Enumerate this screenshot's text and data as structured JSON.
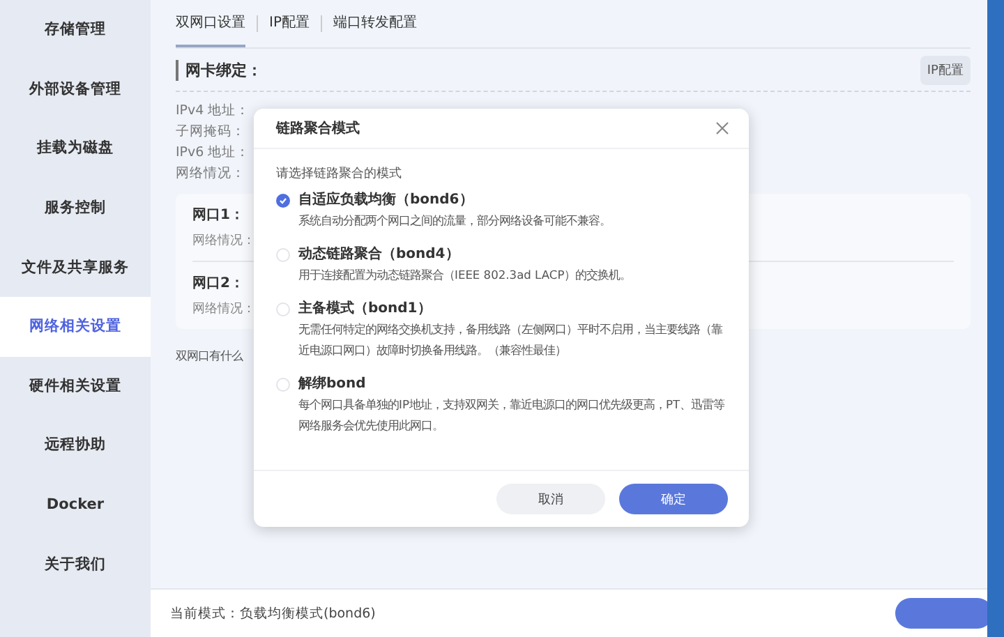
{
  "sidebar": {
    "items": [
      {
        "label": "存储管理",
        "selected": false
      },
      {
        "label": "外部设备管理",
        "selected": false
      },
      {
        "label": "挂载为磁盘",
        "selected": false
      },
      {
        "label": "服务控制",
        "selected": false
      },
      {
        "label": "文件及共享服务",
        "selected": false
      },
      {
        "label": "网络相关设置",
        "selected": true
      },
      {
        "label": "硬件相关设置",
        "selected": false
      },
      {
        "label": "远程协助",
        "selected": false
      },
      {
        "label": "Docker",
        "selected": false
      },
      {
        "label": "关于我们",
        "selected": false
      }
    ]
  },
  "tabs": [
    {
      "label": "双网口设置",
      "selected": true
    },
    {
      "label": "IP配置",
      "selected": false
    },
    {
      "label": "端口转发配置",
      "selected": false
    }
  ],
  "section": {
    "title": "网卡绑定：",
    "button": "IP配置",
    "info": [
      "IPv4 地址：",
      "子网掩码：",
      "IPv6 地址：",
      "网络情况："
    ],
    "ports": [
      {
        "name": "网口1：",
        "status_label": "网络情况："
      },
      {
        "name": "网口2：",
        "status_label": "网络情况："
      }
    ],
    "faq": "双网口有什么"
  },
  "dialog": {
    "title": "链路聚合模式",
    "prompt": "请选择链路聚合的模式",
    "options": [
      {
        "title": "自适应负载均衡（bond6）",
        "description": "系统自动分配两个网口之间的流量，部分网络设备可能不兼容。",
        "selected": true
      },
      {
        "title": "动态链路聚合（bond4）",
        "description": "用于连接配置为动态链路聚合（IEEE 802.3ad LACP）的交换机。",
        "selected": false
      },
      {
        "title": "主备模式（bond1）",
        "description": "无需任何特定的网络交换机支持，备用线路（左侧网口）平时不启用，当主要线路（靠近电源口网口）故障时切换备用线路。（兼容性最佳）",
        "selected": false
      },
      {
        "title": "解绑bond",
        "description": "每个网口具备单独的IP地址，支持双网关，靠近电源口的网口优先级更高，PT、迅雷等网络服务会优先使用此网口。",
        "selected": false
      }
    ],
    "cancel": "取消",
    "confirm": "确定"
  },
  "status_bar": {
    "text": "当前模式：负载均衡模式(bond6)"
  }
}
